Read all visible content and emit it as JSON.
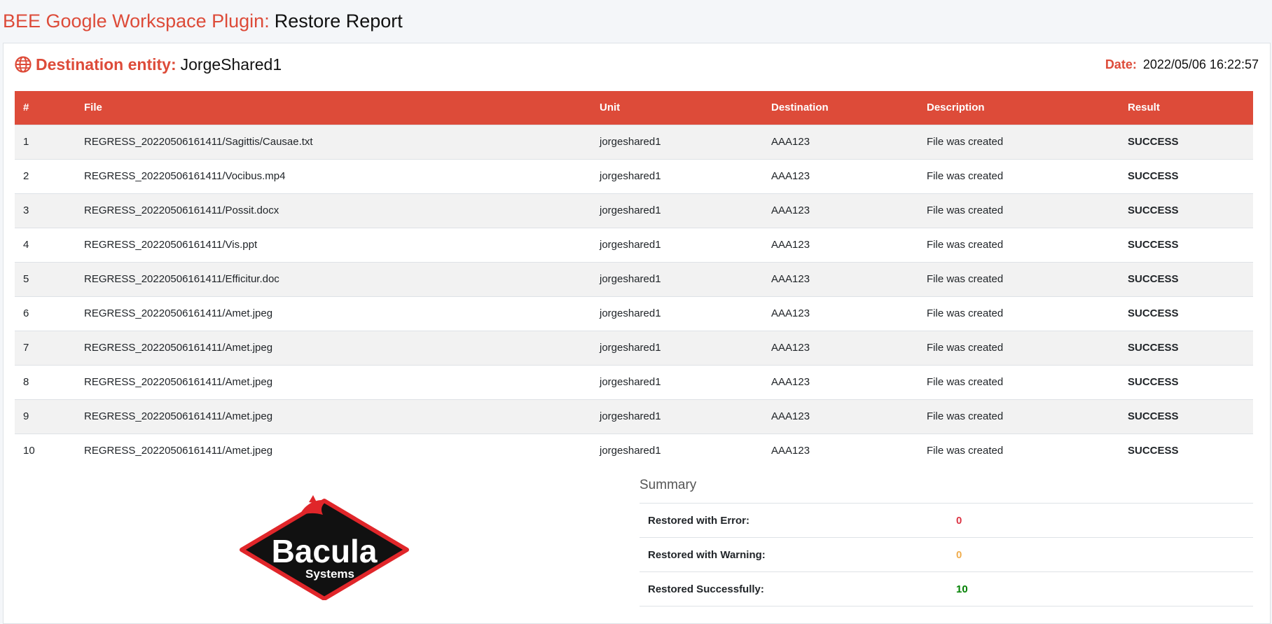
{
  "header": {
    "plugin_name": "BEE Google Workspace Plugin:",
    "report_title": "Restore Report"
  },
  "entity": {
    "label": "Destination entity:",
    "value": "JorgeShared1",
    "icon": "globe-icon"
  },
  "date": {
    "label": "Date:",
    "value": "2022/05/06 16:22:57"
  },
  "colors": {
    "accent": "#dd4b39",
    "success": "#008000",
    "error": "#dc3545",
    "warning": "#f0ad4e"
  },
  "table": {
    "columns": [
      "#",
      "File",
      "Unit",
      "Destination",
      "Description",
      "Result"
    ],
    "rows": [
      {
        "num": "1",
        "file": "REGRESS_20220506161411/Sagittis/Causae.txt",
        "unit": "jorgeshared1",
        "destination": "AAA123",
        "description": "File was created",
        "result": "SUCCESS"
      },
      {
        "num": "2",
        "file": "REGRESS_20220506161411/Vocibus.mp4",
        "unit": "jorgeshared1",
        "destination": "AAA123",
        "description": "File was created",
        "result": "SUCCESS"
      },
      {
        "num": "3",
        "file": "REGRESS_20220506161411/Possit.docx",
        "unit": "jorgeshared1",
        "destination": "AAA123",
        "description": "File was created",
        "result": "SUCCESS"
      },
      {
        "num": "4",
        "file": "REGRESS_20220506161411/Vis.ppt",
        "unit": "jorgeshared1",
        "destination": "AAA123",
        "description": "File was created",
        "result": "SUCCESS"
      },
      {
        "num": "5",
        "file": "REGRESS_20220506161411/Efficitur.doc",
        "unit": "jorgeshared1",
        "destination": "AAA123",
        "description": "File was created",
        "result": "SUCCESS"
      },
      {
        "num": "6",
        "file": "REGRESS_20220506161411/Amet.jpeg",
        "unit": "jorgeshared1",
        "destination": "AAA123",
        "description": "File was created",
        "result": "SUCCESS"
      },
      {
        "num": "7",
        "file": "REGRESS_20220506161411/Amet.jpeg",
        "unit": "jorgeshared1",
        "destination": "AAA123",
        "description": "File was created",
        "result": "SUCCESS"
      },
      {
        "num": "8",
        "file": "REGRESS_20220506161411/Amet.jpeg",
        "unit": "jorgeshared1",
        "destination": "AAA123",
        "description": "File was created",
        "result": "SUCCESS"
      },
      {
        "num": "9",
        "file": "REGRESS_20220506161411/Amet.jpeg",
        "unit": "jorgeshared1",
        "destination": "AAA123",
        "description": "File was created",
        "result": "SUCCESS"
      },
      {
        "num": "10",
        "file": "REGRESS_20220506161411/Amet.jpeg",
        "unit": "jorgeshared1",
        "destination": "AAA123",
        "description": "File was created",
        "result": "SUCCESS"
      }
    ]
  },
  "logo": {
    "brand": "Bacula",
    "tagline": "Systems"
  },
  "summary": {
    "title": "Summary",
    "items": [
      {
        "label": "Restored with Error:",
        "value": "0",
        "color": "#dc3545"
      },
      {
        "label": "Restored with Warning:",
        "value": "0",
        "color": "#f0ad4e"
      },
      {
        "label": "Restored Successfully:",
        "value": "10",
        "color": "#008000"
      }
    ]
  }
}
